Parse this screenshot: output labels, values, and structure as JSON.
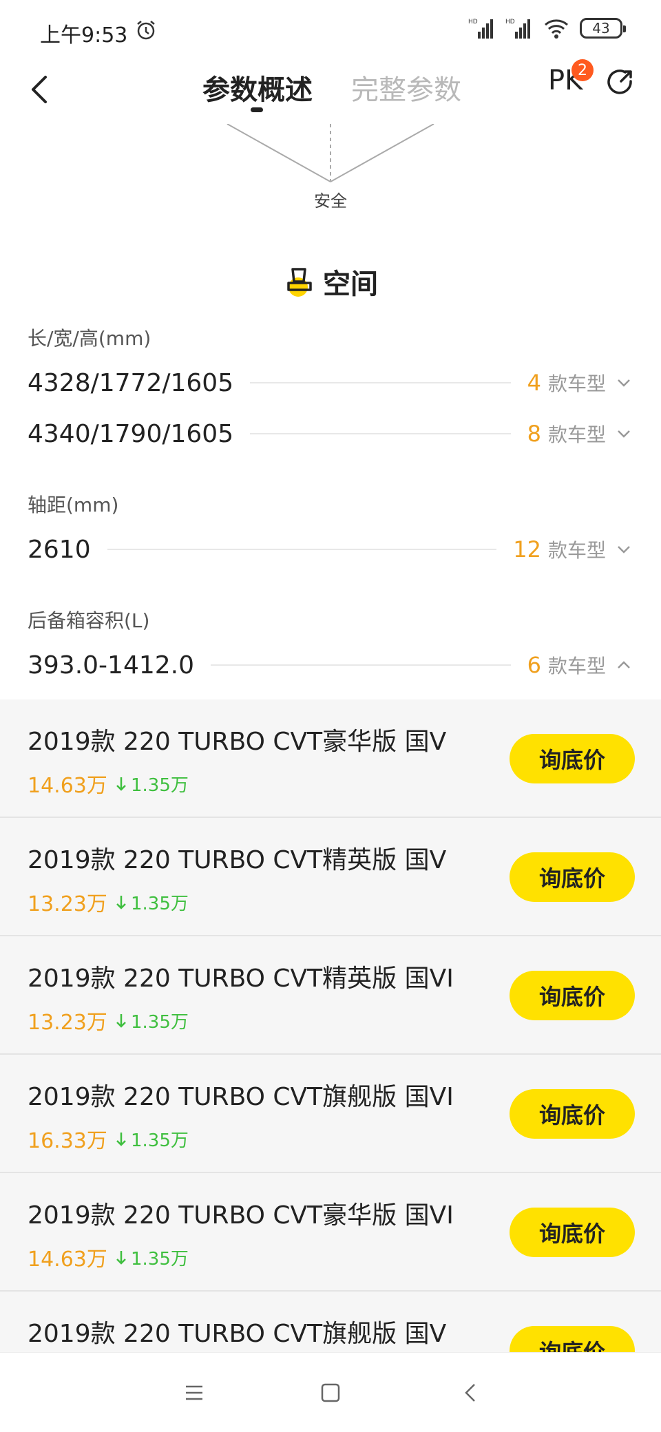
{
  "status_bar": {
    "time": "上午9:53",
    "battery": "43"
  },
  "header": {
    "tabs": [
      {
        "label": "参数概述"
      },
      {
        "label": "完整参数"
      }
    ],
    "pk_label": "PK",
    "pk_badge": "2"
  },
  "radar": {
    "labels": [
      "安全"
    ]
  },
  "section": {
    "title": "空间"
  },
  "params": {
    "dimensions": {
      "label": "长/宽/高(mm)",
      "rows": [
        {
          "value": "4328/1772/1605",
          "count": "4",
          "unit": "款车型"
        },
        {
          "value": "4340/1790/1605",
          "count": "8",
          "unit": "款车型"
        }
      ]
    },
    "wheelbase": {
      "label": "轴距(mm)",
      "rows": [
        {
          "value": "2610",
          "count": "12",
          "unit": "款车型"
        }
      ]
    },
    "trunk": {
      "label": "后备箱容积(L)",
      "rows": [
        {
          "value": "393.0-1412.0",
          "count": "6",
          "unit": "款车型"
        }
      ]
    }
  },
  "models": [
    {
      "name": "2019款 220 TURBO CVT豪华版 国V",
      "price": "14.63万",
      "drop": "1.35万",
      "button": "询底价"
    },
    {
      "name": "2019款 220 TURBO CVT精英版 国V",
      "price": "13.23万",
      "drop": "1.35万",
      "button": "询底价"
    },
    {
      "name": "2019款 220 TURBO CVT精英版 国VI",
      "price": "13.23万",
      "drop": "1.35万",
      "button": "询底价"
    },
    {
      "name": "2019款 220 TURBO CVT旗舰版 国VI",
      "price": "16.33万",
      "drop": "1.35万",
      "button": "询底价"
    },
    {
      "name": "2019款 220 TURBO CVT豪华版 国VI",
      "price": "14.63万",
      "drop": "1.35万",
      "button": "询底价"
    },
    {
      "name": "2019款 220 TURBO CVT旗舰版 国V",
      "price": "",
      "drop": "",
      "button": "询底价"
    }
  ],
  "colors": {
    "accent": "#f0a01e",
    "button": "#ffe100",
    "drop": "#3fbf3f",
    "badge": "#ff5a1f"
  }
}
